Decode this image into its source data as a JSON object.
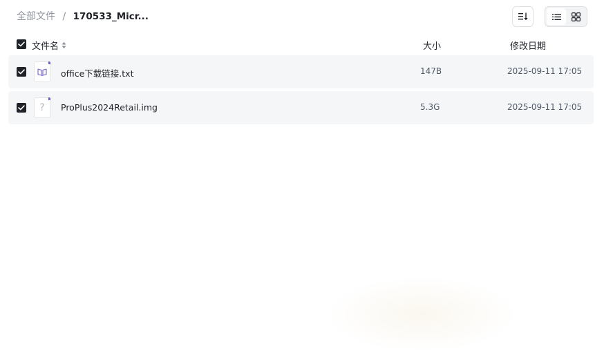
{
  "breadcrumb": {
    "root": "全部文件",
    "separator": "/",
    "current": "170533_Micr..."
  },
  "toolbar": {
    "sort_icon": "sort-list-icon",
    "list_view_icon": "list-view-icon",
    "grid_view_icon": "grid-view-icon",
    "active_view": "list"
  },
  "table": {
    "headers": {
      "name": "文件名",
      "size": "大小",
      "date": "修改日期"
    },
    "all_selected": true,
    "rows": [
      {
        "name": "office下载链接.txt",
        "size": "147B",
        "date": "2025-09-11 17:05",
        "icon": "text-file-icon",
        "selected": true
      },
      {
        "name": "ProPlus2024Retail.img",
        "size": "5.3G",
        "date": "2025-09-11 17:05",
        "icon": "unknown-file-icon",
        "selected": true
      }
    ]
  },
  "colors": {
    "row_background": "#f5f6f7",
    "checkbox": "#1f2329",
    "txt_icon_accent": "#6e62c9",
    "muted_text": "#8f959e"
  }
}
